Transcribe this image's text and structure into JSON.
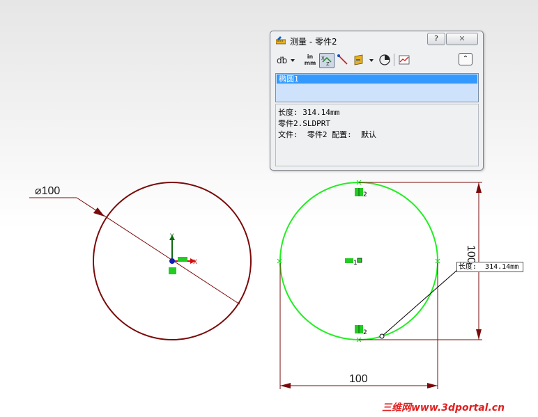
{
  "dialog": {
    "title": "测量 - 零件2",
    "help_label": "?",
    "close_label": "✕",
    "toolbar": {
      "units_label": "in\nmm",
      "collapse_label": "⌃"
    },
    "selection_item": "椭圆1",
    "results": [
      "长度: 314.14mm",
      "零件2.SLDPRT",
      "文件:  零件2 配置:  默认"
    ]
  },
  "sketch": {
    "left_dimension": "⌀100",
    "bottom_dimension": "100",
    "right_dimension": "100",
    "callout_text": "长度:  314.14mm",
    "axis_x_label": "X",
    "axis_y_label": "Y",
    "relation_label_top": "2",
    "relation_label_center": "1",
    "relation_label_bottom": "2"
  },
  "watermark": "三维网www.3dportal.cn",
  "colors": {
    "dark_red": "#7a0a0a",
    "green": "#22ee22",
    "selection_blue": "#3399ff"
  }
}
